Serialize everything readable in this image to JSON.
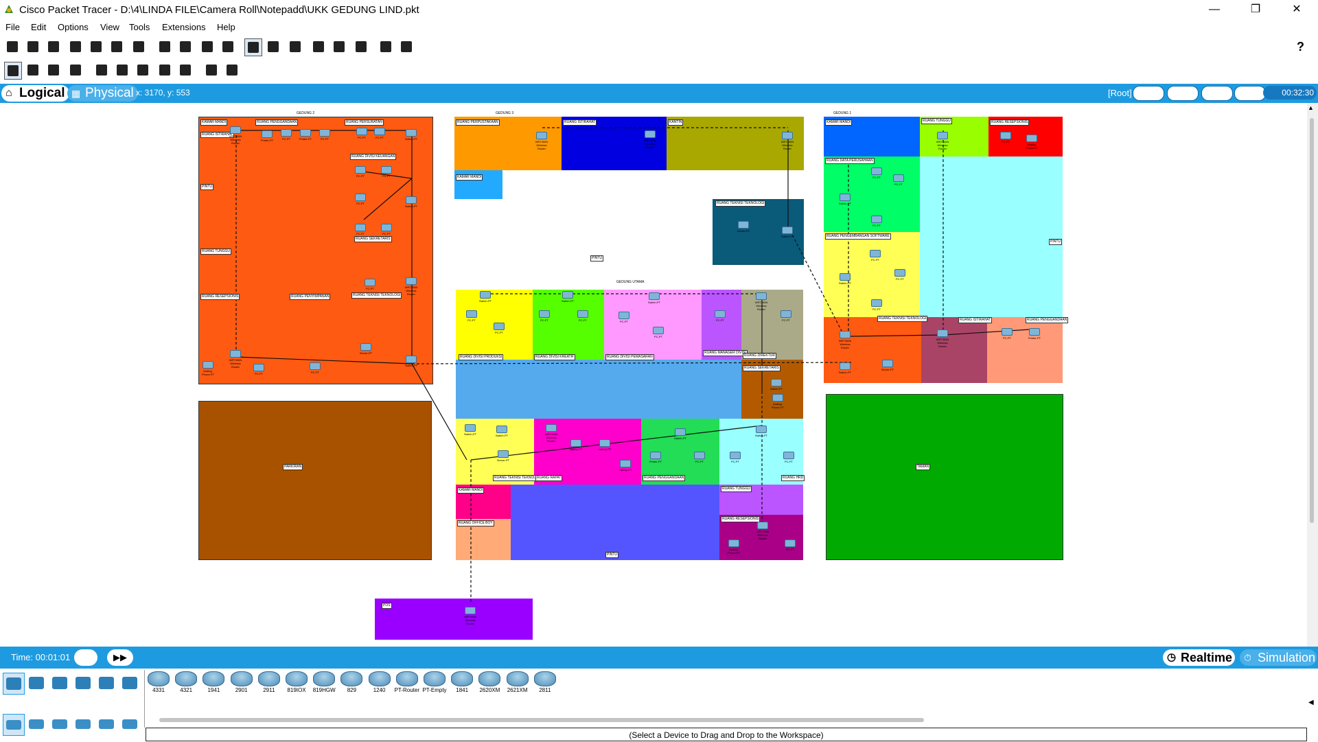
{
  "window": {
    "title": "Cisco Packet Tracer - D:\\4\\LINDA FILE\\Camera Roll\\Notepadd\\UKK GEDUNG LIND.pkt",
    "minimize": "—",
    "restore": "❐",
    "close": "✕"
  },
  "menu": [
    "File",
    "Edit",
    "Options",
    "View",
    "Tools",
    "Extensions",
    "Help"
  ],
  "toolbar_main_icons": [
    "new-file-icon",
    "open-folder-icon",
    "save-icon",
    "print-icon",
    "info-icon",
    "network-wizard-icon",
    "activity-wizard-icon",
    "copy-icon",
    "paste-icon",
    "undo-icon",
    "redo-icon",
    "zoom-in-icon",
    "zoom-reset-icon",
    "zoom-out-icon",
    "drawing-palette-icon",
    "custom-device-icon",
    "text-file-icon",
    "pdu-list-icon",
    "image-icon"
  ],
  "help_icon": "?",
  "toolbar_tools_icons": [
    "select-icon",
    "inspect-icon",
    "delete-icon",
    "resize-icon",
    "note-icon",
    "line-icon",
    "rectangle-icon",
    "ellipse-icon",
    "freeform-icon",
    "simple-pdu-icon",
    "complex-pdu-icon"
  ],
  "modebar": {
    "logical_label": "Logical",
    "physical_label": "Physical",
    "coordinates": "x: 3170, y: 553",
    "root_label": "[Root]",
    "clock": "00:32:30"
  },
  "buildings": {
    "gedung2": "GEDUNG 2",
    "gedung3": "GEDUNG 3",
    "gedung1": "GEDUNG 1",
    "utama": "GEDUNG UTAMA"
  },
  "rooms": {
    "kamar_mandi": "KAMAR MANDI",
    "ruang_istirahat": "RUANG ISTIRAHAT",
    "ruang_penggandaan": "RUANG PENGGANDAAN",
    "ruang_persuratan": "RUANG PERSURATAN",
    "ruang_divisi_keuangan": "RUANG DIVISI KEUANGAN",
    "pintu": "PINTU",
    "ruang_tunggu": "RUANG TUNGGU",
    "ruang_sekretaris": "RUANG SEKRETARIS",
    "ruang_resepsionis": "RUANG RESEPSIONIS",
    "ruang_penyimpanan": "RUANG PENYIMPANAN",
    "ruang_teknisi_teknologi": "RUANG TEKNISI TEKNOLOGI",
    "parkiran": "PARKIRAN",
    "ruang_perpustakaan": "RUANG PERPUSTAKAAN",
    "kantin": "KANTIN",
    "ruang_data_perusahaan": "RUANG DATA PERUSAHAAN",
    "ruang_pengembangan_software": "RUANG PENGEMBANGAN SOFTWARE",
    "taman": "TAMAN",
    "ruang_divisi_produksi": "RUANG DIVISI PRODUKSI",
    "ruang_divisi_kreatif": "RUANG DIVISI KREATIF",
    "ruang_divisi_pemasaran": "RUANG DIVISI PEMASARAN",
    "ruang_manager_divisi": "RUANG MANAGER DIVISI",
    "ruang_direktur": "RUANG DIREKTUR",
    "ruang_teknisi_teknologi_2": "RUANG TEKNISI TEKNOL",
    "ruang_rapat": "RUANG RAPAT",
    "ruang_hrd": "RUANG HRD",
    "ruang_office_boy": "RUANG OFFICE BOY",
    "pos": "POS"
  },
  "devices": {
    "router": "WRT300N Wireless Router",
    "switch": "Switch-PT",
    "pc": "PC-PT",
    "printer": "Printer-PT",
    "server": "Server-PT",
    "phone": "Analog-Phone-PT",
    "laptop": "Laptop-PT"
  },
  "timebar": {
    "time": "Time: 00:01:01",
    "realtime": "Realtime",
    "simulation": "Simulation"
  },
  "device_models": [
    "4331",
    "4321",
    "1941",
    "2901",
    "2911",
    "819IOX",
    "819HGW",
    "829",
    "1240",
    "PT-Router",
    "PT-Empty",
    "1841",
    "2620XM",
    "2621XM",
    "2811"
  ],
  "device_categories_top": [
    "network-devices-icon",
    "end-devices-icon",
    "components-icon",
    "connections-icon",
    "miscellaneous-icon",
    "multiuser-icon"
  ],
  "device_categories_sub": [
    "routers-icon",
    "switches-icon",
    "hubs-icon",
    "wireless-icon",
    "security-icon",
    "wan-emulation-icon"
  ],
  "status_message": "(Select a Device to Drag and Drop to the Workspace)",
  "colors": {
    "accent_blue": "#1e9be0",
    "orange": "#ff5a12",
    "brown": "#a85200",
    "green": "#00aa00",
    "purple": "#9a00ff"
  }
}
